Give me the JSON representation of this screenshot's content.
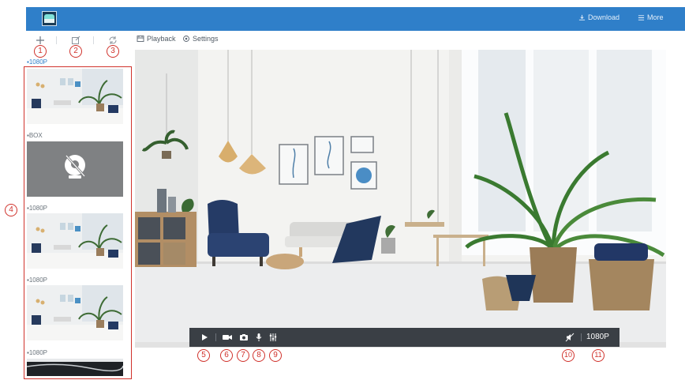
{
  "topbar": {
    "download_label": "Download",
    "more_label": "More"
  },
  "toolbar": {
    "add_icon": "plus-icon",
    "edit_icon": "edit-icon",
    "refresh_icon": "refresh-icon",
    "playback_label": "Playback",
    "settings_label": "Settings"
  },
  "callouts": [
    "1",
    "2",
    "3",
    "4",
    "5",
    "6",
    "7",
    "8",
    "9",
    "10",
    "11"
  ],
  "sidebar": {
    "items": [
      {
        "label": "1080P",
        "state": "live"
      },
      {
        "label": "BOX",
        "state": "offline"
      },
      {
        "label": "1080P",
        "state": "live"
      },
      {
        "label": "1080P",
        "state": "live"
      },
      {
        "label": "1080P",
        "state": "live"
      }
    ]
  },
  "controls": {
    "quality_label": "1080P"
  },
  "colors": {
    "brand_blue": "#2f7fc9",
    "callout_red": "#d0322c",
    "control_bar": "#3a3f45"
  }
}
